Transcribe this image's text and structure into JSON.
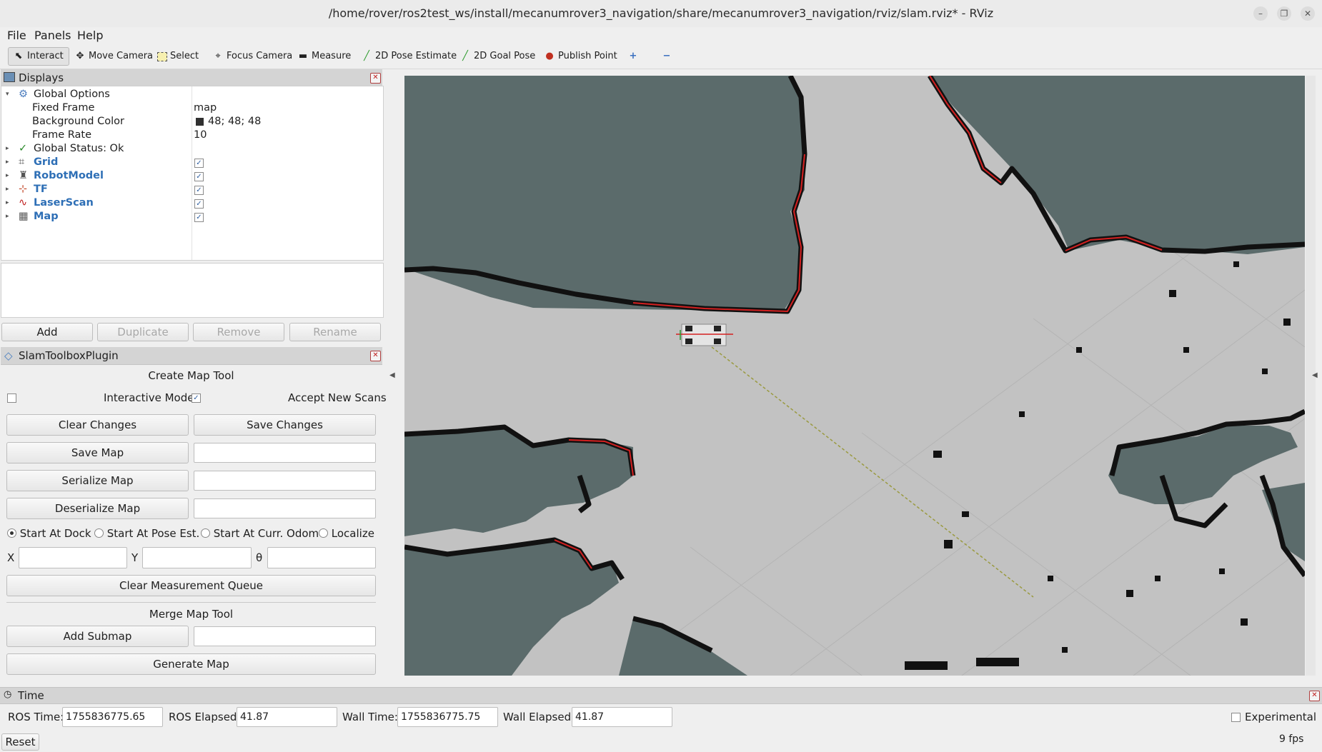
{
  "window": {
    "title": "/home/rover/ros2test_ws/install/mecanumrover3_navigation/share/mecanumrover3_navigation/rviz/slam.rviz* - RViz"
  },
  "menu": [
    "File",
    "Panels",
    "Help"
  ],
  "toolbar": {
    "tools": [
      "Interact",
      "Move Camera",
      "Select",
      "Focus Camera",
      "Measure",
      "2D Pose Estimate",
      "2D Goal Pose",
      "Publish Point"
    ],
    "active": "Interact"
  },
  "displays": {
    "header": "Displays",
    "global_options": "Global Options",
    "rows": [
      {
        "name": "Fixed Frame",
        "value": "map"
      },
      {
        "name": "Background Color",
        "value": "48; 48; 48"
      },
      {
        "name": "Frame Rate",
        "value": "10"
      }
    ],
    "global_status": "Global Status: Ok",
    "items": [
      {
        "name": "Grid",
        "checked": true
      },
      {
        "name": "RobotModel",
        "checked": true
      },
      {
        "name": "TF",
        "checked": true
      },
      {
        "name": "LaserScan",
        "checked": true
      },
      {
        "name": "Map",
        "checked": true
      }
    ],
    "buttons": {
      "add": "Add",
      "duplicate": "Duplicate",
      "remove": "Remove",
      "rename": "Rename"
    }
  },
  "slam": {
    "header": "SlamToolboxPlugin",
    "create_title": "Create Map Tool",
    "interactive_mode": "Interactive Mode",
    "interactive_checked": true,
    "accept_new_scans": "Accept New Scans",
    "clear_changes": "Clear Changes",
    "save_changes": "Save Changes",
    "save_map": "Save Map",
    "serialize_map": "Serialize Map",
    "deserialize_map": "Deserialize Map",
    "radios": [
      "Start At Dock",
      "Start At Pose Est.",
      "Start At Curr. Odom",
      "Localize"
    ],
    "selected_radio": "Start At Dock",
    "x_label": "X",
    "y_label": "Y",
    "theta_label": "θ",
    "clear_queue": "Clear Measurement Queue",
    "merge_title": "Merge Map Tool",
    "add_submap": "Add Submap",
    "generate_map": "Generate Map"
  },
  "time": {
    "header": "Time",
    "ros_time_label": "ROS Time:",
    "ros_time": "1755836775.65",
    "ros_elapsed_label": "ROS Elapsed:",
    "ros_elapsed": "41.87",
    "wall_time_label": "Wall Time:",
    "wall_time": "1755836775.75",
    "wall_elapsed_label": "Wall Elapsed:",
    "wall_elapsed": "41.87",
    "experimental": "Experimental",
    "reset": "Reset",
    "fps": "9 fps"
  },
  "colors": {
    "map_free": "#c2c2c2",
    "map_unknown": "#5b6b6b",
    "obstacle": "#111111",
    "laser": "#d42020"
  }
}
